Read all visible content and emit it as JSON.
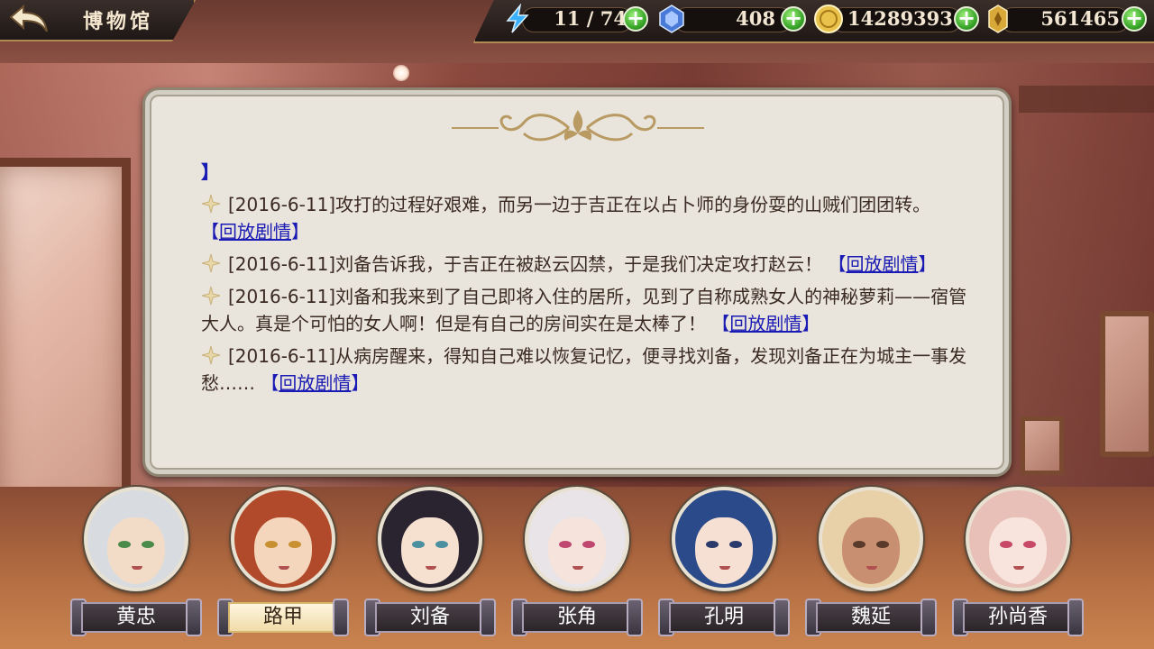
{
  "header": {
    "back_icon": "back-arrow-icon",
    "title": "博物馆"
  },
  "resources": [
    {
      "id": "stamina",
      "icon": "lightning-icon",
      "value": "11 / 74",
      "color": "#3ab0ff"
    },
    {
      "id": "gem",
      "icon": "blue-gem-icon",
      "value": "408",
      "color": "#6aa8ff"
    },
    {
      "id": "coin",
      "icon": "gold-coin-icon",
      "value": "14289393",
      "color": "#e8c24a"
    },
    {
      "id": "token",
      "icon": "gold-token-icon",
      "value": "561465",
      "color": "#d8a838"
    }
  ],
  "log": {
    "fragment": "】",
    "entries": [
      {
        "text": "[2016-6-11]攻打的过程好艰难，而另一边于吉正在以占卜师的身份耍的山贼们团团转。",
        "replay": "回放剧情"
      },
      {
        "text": "[2016-6-11]刘备告诉我，于吉正在被赵云囚禁，于是我们决定攻打赵云！",
        "replay": "回放剧情"
      },
      {
        "text": "[2016-6-11]刘备和我来到了自己即将入住的居所，见到了自称成熟女人的神秘萝莉——宿管大人。真是个可怕的女人啊！但是有自己的房间实在是太棒了！",
        "replay": "回放剧情"
      },
      {
        "text": "[2016-6-11]从病房醒来，得知自己难以恢复记忆，便寻找刘备，发现刘备正在为城主一事发愁……",
        "replay": "回放剧情"
      }
    ]
  },
  "characters": [
    {
      "name": "黄忠",
      "selected": false,
      "hair": "#d8dce0",
      "skin": "#f2dcc8",
      "eye": "#4a8a4a"
    },
    {
      "name": "路甲",
      "selected": true,
      "hair": "#b04a2a",
      "skin": "#f4d6bc",
      "eye": "#c89030"
    },
    {
      "name": "刘备",
      "selected": false,
      "hair": "#2a2430",
      "skin": "#f6e0d0",
      "eye": "#4a90a0"
    },
    {
      "name": "张角",
      "selected": false,
      "hair": "#e8e4e8",
      "skin": "#f6e4dc",
      "eye": "#c04870"
    },
    {
      "name": "孔明",
      "selected": false,
      "hair": "#2a4a8a",
      "skin": "#f6e0d4",
      "eye": "#2a3a6a"
    },
    {
      "name": "魏延",
      "selected": false,
      "hair": "#e8d0a8",
      "skin": "#c89070",
      "eye": "#5a3a2a"
    },
    {
      "name": "孙尚香",
      "selected": false,
      "hair": "#e8c0b8",
      "skin": "#f8e4dc",
      "eye": "#c84868"
    }
  ]
}
